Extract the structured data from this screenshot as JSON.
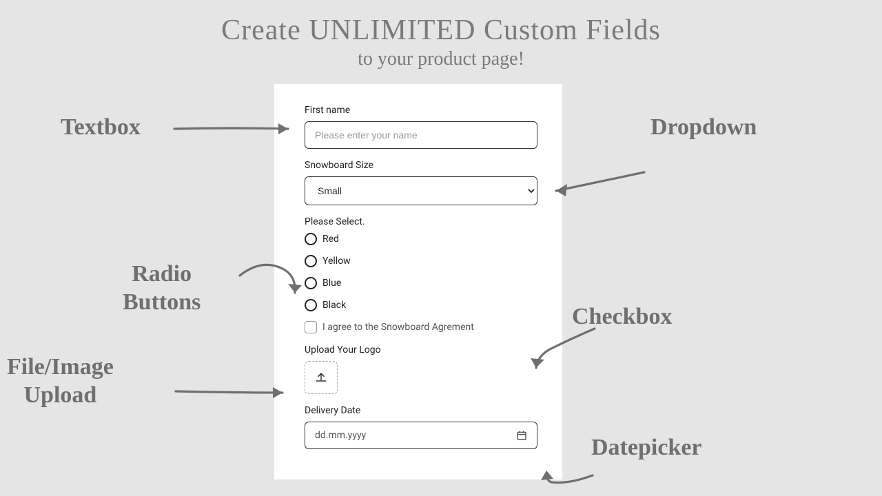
{
  "heading": {
    "title": "Create UNLIMITED Custom Fields",
    "subtitle": "to your product page!"
  },
  "form": {
    "first_name_label": "First name",
    "first_name_placeholder": "Please enter your name",
    "size_label": "Snowboard Size",
    "size_selected": "Small",
    "radio_label": "Please Select.",
    "radio_options": [
      "Red",
      "Yellow",
      "Blue",
      "Black"
    ],
    "checkbox_label": "I agree to the Snowboard Agrement",
    "upload_label": "Upload Your Logo",
    "date_label": "Delivery Date",
    "date_placeholder": "dd.mm.yyyy"
  },
  "callouts": {
    "textbox": "Textbox",
    "dropdown": "Dropdown",
    "radio_line1": "Radio",
    "radio_line2": "Buttons",
    "checkbox": "Checkbox",
    "upload_line1": "File/Image",
    "upload_line2": "Upload",
    "datepicker": "Datepicker"
  }
}
